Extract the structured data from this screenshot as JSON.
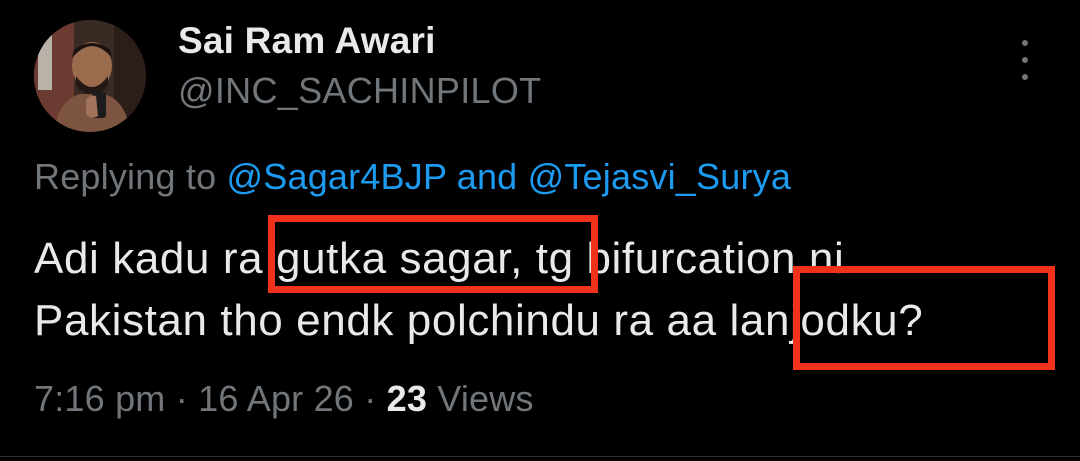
{
  "tweet": {
    "author": {
      "display_name": "Sai Ram Awari",
      "handle": "@INC_SACHINPILOT",
      "avatar_icon": "profile-photo"
    },
    "more_icon": "vertical-ellipsis-icon",
    "reply": {
      "prefix": "Replying to",
      "mention_1": "@Sagar4BJP",
      "conjunction": "and",
      "mention_2": "@Tejasvi_Surya"
    },
    "text": {
      "line1_a": "Adi kadu r",
      "line1_b": "a gutka sagar,",
      "line1_c": " tg bifurcation ni",
      "line2_a": "Pakistan tho endk polchindu ra a",
      "line2_b": "a lanjodku?"
    },
    "meta": {
      "time": "7:16 pm",
      "separator": "·",
      "date": "16 Apr 26",
      "views_count": "23",
      "views_label": "Views"
    }
  },
  "colors": {
    "background": "#000000",
    "text_primary": "#e7e9ea",
    "text_secondary": "#71767b",
    "link": "#1d9bf0",
    "annotation_box": "#f0311b"
  }
}
